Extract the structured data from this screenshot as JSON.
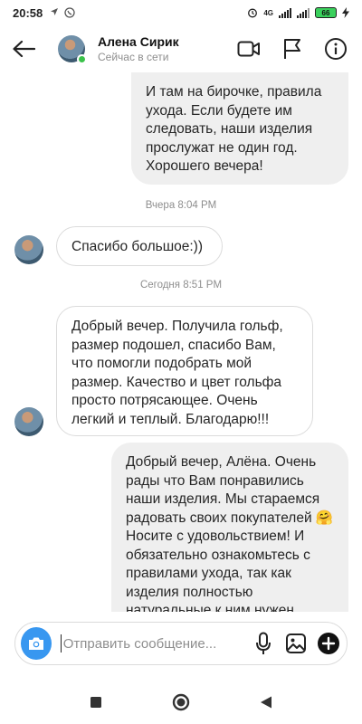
{
  "status_bar": {
    "time": "20:58",
    "network": "4G",
    "battery": "66"
  },
  "header": {
    "contact_name": "Алена Сирик",
    "contact_status": "Сейчас в сети"
  },
  "messages": [
    {
      "direction": "out",
      "text": "И там на бирочке, правила ухода. Если будете им следовать, наши изделия прослужат не один год. Хорошего вечера!"
    },
    {
      "type": "timestamp",
      "text": "Вчера 8:04 PM"
    },
    {
      "direction": "in",
      "text": "Спасибо большое:))"
    },
    {
      "type": "timestamp",
      "text": "Сегодня 8:51 PM"
    },
    {
      "direction": "in",
      "text": "Добрый вечер. Получила гольф, размер подошел, спасибо Вам, что помогли подобрать мой размер. Качество и цвет гольфа просто потрясающее. Очень легкий и теплый. Благодарю!!!"
    },
    {
      "direction": "out",
      "text": "Добрый вечер, Алёна. Очень рады что Вам понравились наши изделия. Мы стараемся радовать своих покупателей 🤗 Носите с удовольствием! И обязательно ознакомьтесь с правилами ухода, так как изделия полностью натуральные к ним нужен"
    }
  ],
  "composer": {
    "placeholder": "Отправить сообщение..."
  },
  "icons": {
    "back": "arrow-left-icon",
    "video": "video-camera-icon",
    "flag": "flag-icon",
    "info": "info-icon",
    "camera": "camera-icon",
    "mic": "microphone-icon",
    "gallery": "image-icon",
    "add": "plus-circle-icon"
  },
  "colors": {
    "accent": "#3897f0",
    "online": "#3ac24a",
    "bubble_out": "#efefef",
    "timestamp": "#8e8e8e"
  }
}
